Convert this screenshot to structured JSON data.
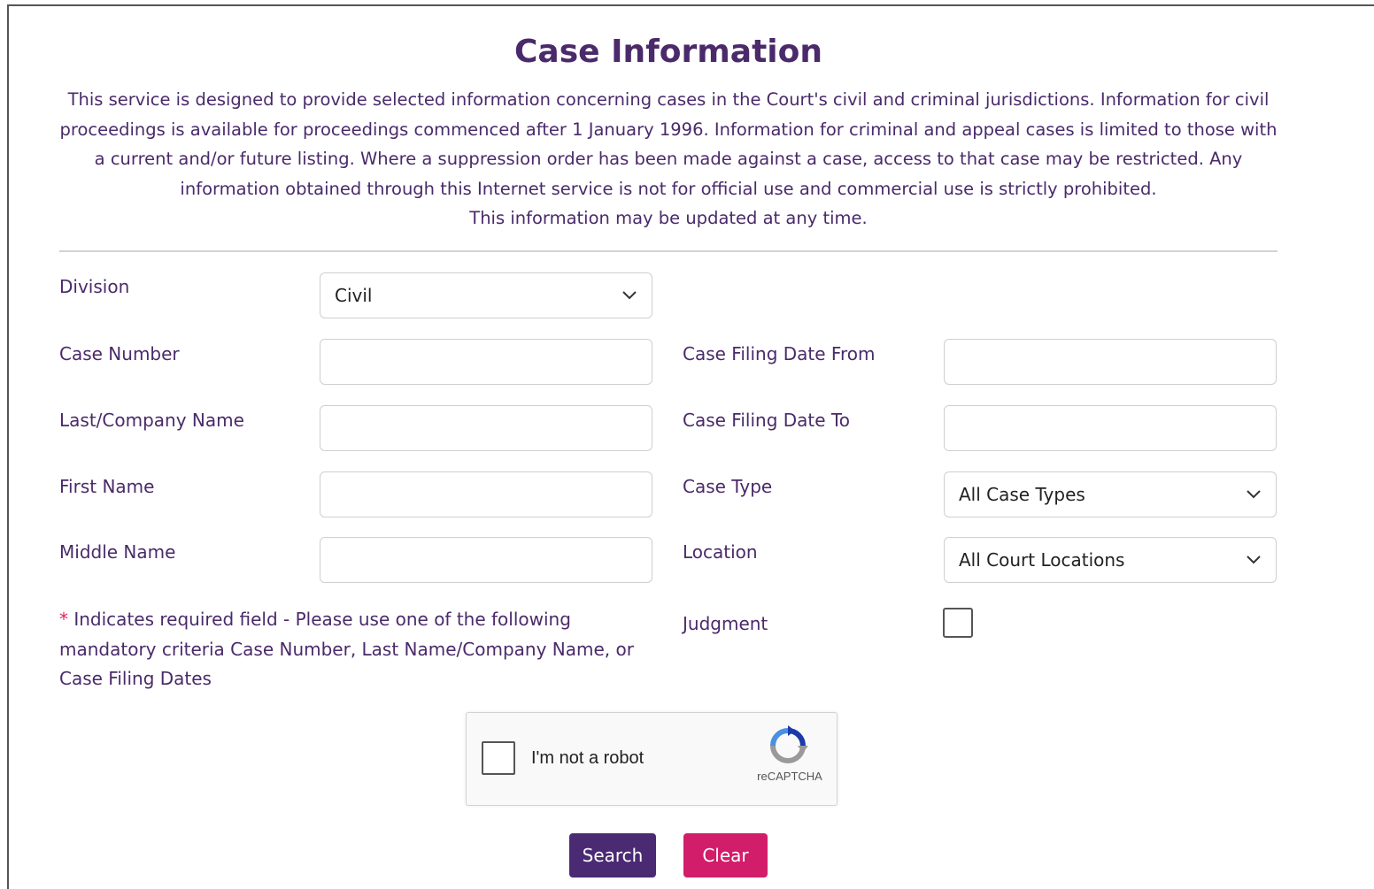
{
  "page": {
    "title": "Case Information",
    "intro_paragraph": "This service is designed to provide selected information concerning cases in the Court's civil and criminal jurisdictions. Information for civil proceedings is available for proceedings commenced after 1 January 1996. Information for criminal and appeal cases is limited to those with a current and/or future listing. Where a suppression order has been made against a case, access to that case may be restricted. Any information obtained through this Internet service is not for official use and commercial use is strictly prohibited.",
    "intro_update": "This information may be updated at any time."
  },
  "form": {
    "division": {
      "label": "Division",
      "value": "Civil"
    },
    "case_number": {
      "label": "Case Number",
      "value": ""
    },
    "last_company_name": {
      "label": "Last/Company Name",
      "value": ""
    },
    "first_name": {
      "label": "First Name",
      "value": ""
    },
    "middle_name": {
      "label": "Middle Name",
      "value": ""
    },
    "filing_date_from": {
      "label": "Case Filing Date From",
      "value": ""
    },
    "filing_date_to": {
      "label": "Case Filing Date To",
      "value": ""
    },
    "case_type": {
      "label": "Case Type",
      "value": "All Case Types"
    },
    "location": {
      "label": "Location",
      "value": "All Court Locations"
    },
    "judgment": {
      "label": "Judgment",
      "checked": false
    },
    "required_note": {
      "star": "*",
      "text": "Indicates required field - Please use one of the following mandatory criteria Case Number, Last Name/Company Name, or Case Filing Dates"
    }
  },
  "captcha": {
    "label": "I'm not a robot",
    "brand": "reCAPTCHA"
  },
  "buttons": {
    "search": "Search",
    "clear": "Clear"
  },
  "colors": {
    "primary_text": "#4a2a6a",
    "search_button": "#4b2a74",
    "clear_button": "#d11d6a",
    "required_star": "#e0245e"
  }
}
